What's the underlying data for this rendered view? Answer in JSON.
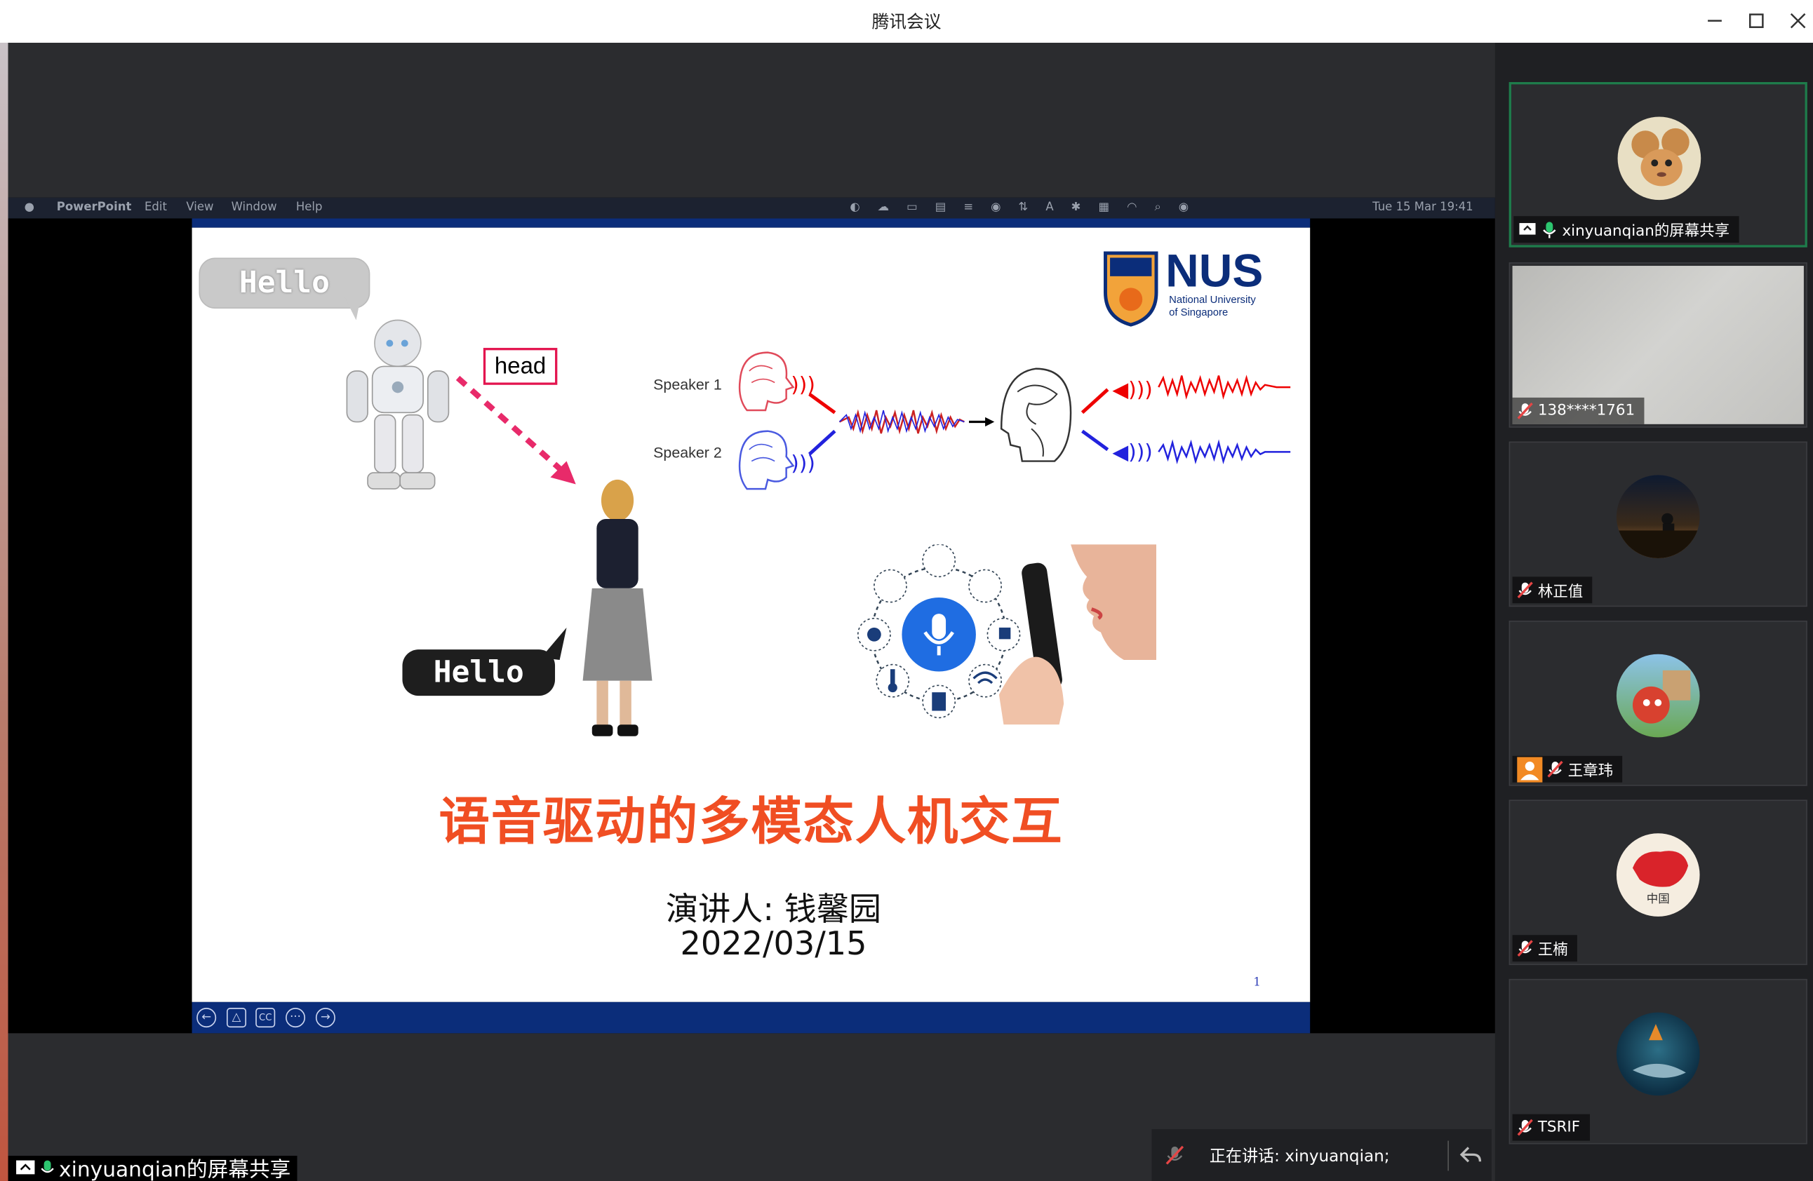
{
  "window": {
    "title": "腾讯会议"
  },
  "mac_menubar": {
    "app": "PowerPoint",
    "menus": [
      "Edit",
      "View",
      "Window",
      "Help"
    ],
    "datetime": "Tue 15 Mar  19:41"
  },
  "slide": {
    "hello_top": "Hello",
    "head_label": "head",
    "hello_bottom": "Hello",
    "speaker1": "Speaker 1",
    "speaker2": "Speaker 2",
    "logo_text": "NUS",
    "logo_sub1": "National University",
    "logo_sub2": "of Singapore",
    "title": "语音驱动的多模态人机交互",
    "presenter": "演讲人: 钱馨园",
    "date": "2022/03/15",
    "page_number": "1"
  },
  "participants": [
    {
      "name": "xinyuanqian的屏幕共享",
      "mic": "on",
      "sharing": true
    },
    {
      "name": "138****1761",
      "mic": "muted"
    },
    {
      "name": "林正值",
      "mic": "muted"
    },
    {
      "name": "王章玮",
      "mic": "muted"
    },
    {
      "name": "王楠",
      "mic": "muted"
    },
    {
      "name": "TSRIF",
      "mic": "muted"
    }
  ],
  "speaking": {
    "text": "正在讲话: xinyuanqian;"
  },
  "bottom_share_label": "xinyuanqian的屏幕共享",
  "colors": {
    "accent_green": "#1e7c4b",
    "slide_title": "#f04e23",
    "nus_blue": "#0b2d7a"
  }
}
